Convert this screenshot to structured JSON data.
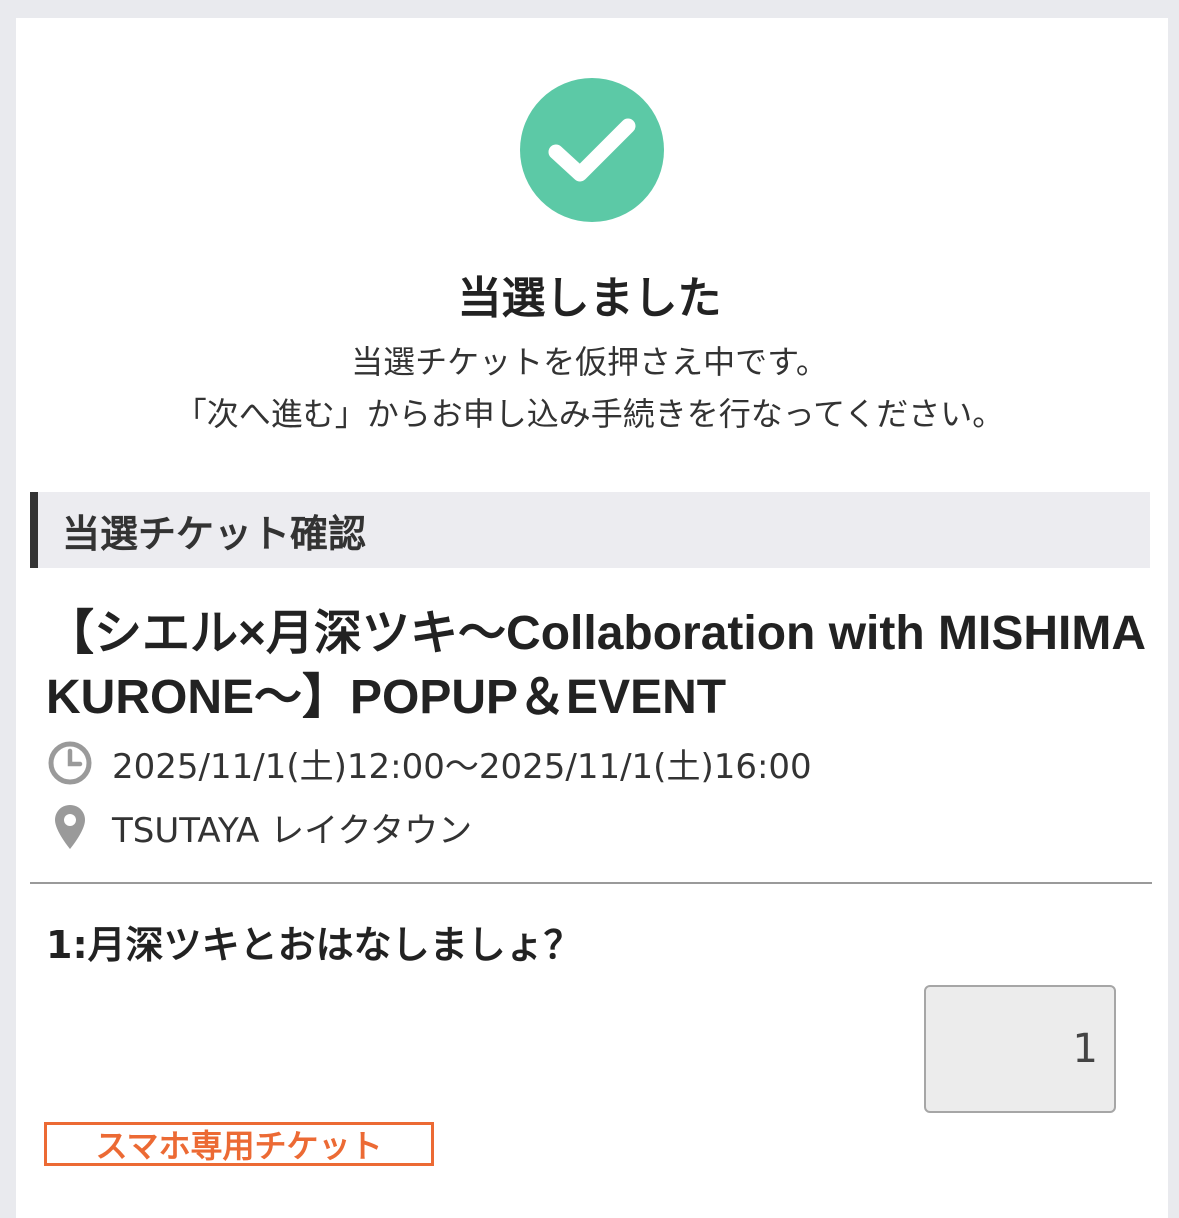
{
  "result": {
    "title": "当選しました",
    "message_line1": "当選チケットを仮押さえ中です。",
    "message_line2": "「次へ進む」からお申し込み手続きを行なってください。",
    "icon": "check-circle-icon",
    "accent_color": "#5cc9a6"
  },
  "section": {
    "heading": "当選チケット確認"
  },
  "event": {
    "title": "【シエル×月深ツキ〜Collaboration with MISHIMA KURONE〜】POPUP＆EVENT",
    "datetime": "2025/11/1(土)12:00〜2025/11/1(土)16:00",
    "datetime_icon": "clock-icon",
    "venue": "TSUTAYA レイクタウン",
    "venue_icon": "location-pin-icon"
  },
  "ticket": {
    "name": "1:月深ツキとおはなしましょ？",
    "quantity": "1",
    "badge": "スマホ専用チケット",
    "badge_color": "#ec6a34"
  }
}
